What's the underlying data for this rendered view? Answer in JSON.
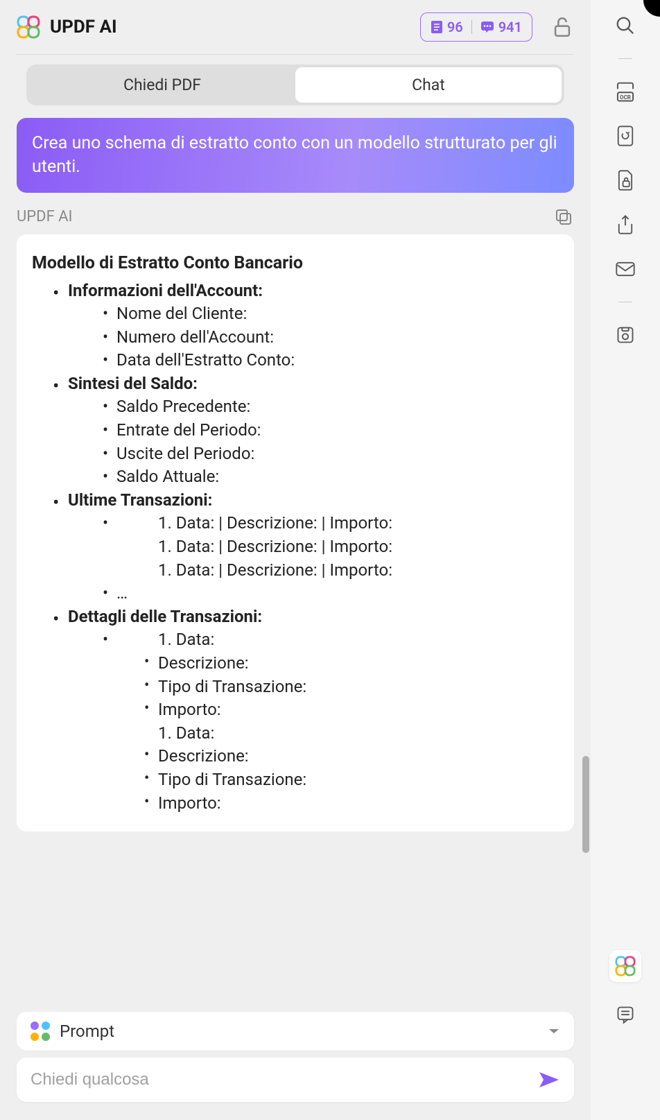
{
  "header": {
    "app_title": "UPDF AI",
    "pages_count": "96",
    "messages_count": "941"
  },
  "tabs": {
    "ask_pdf": "Chiedi PDF",
    "chat": "Chat"
  },
  "user_message": "Crea uno schema di estratto conto con un modello strutturato per gli utenti.",
  "ai_label": "UPDF AI",
  "response": {
    "title": "Modello di Estratto Conto Bancario",
    "sections": [
      {
        "heading": "Informazioni dell'Account:",
        "items": [
          "Nome del Cliente:",
          "Numero dell'Account:",
          "Data dell'Estratto Conto:"
        ]
      },
      {
        "heading": "Sintesi del Saldo:",
        "items": [
          "Saldo Precedente:",
          "Entrate del Periodo:",
          "Uscite del Periodo:",
          "Saldo Attuale:"
        ]
      },
      {
        "heading": "Ultime Transazioni:",
        "tx_rows": [
          "1. Data: | Descrizione: | Importo:",
          "1. Data: | Descrizione: | Importo:",
          "1. Data: | Descrizione: | Importo:"
        ],
        "ellipsis": "…"
      },
      {
        "heading": "Dettagli delle Transazioni:",
        "detail_blocks": [
          {
            "num": "1. Data:",
            "fields": [
              "Descrizione:",
              "Tipo di Transazione:",
              "Importo:"
            ]
          },
          {
            "num": "1. Data:",
            "fields": [
              "Descrizione:",
              "Tipo di Transazione:",
              "Importo:"
            ]
          }
        ]
      }
    ]
  },
  "footer": {
    "prompt_label": "Prompt",
    "input_placeholder": "Chiedi qualcosa"
  }
}
